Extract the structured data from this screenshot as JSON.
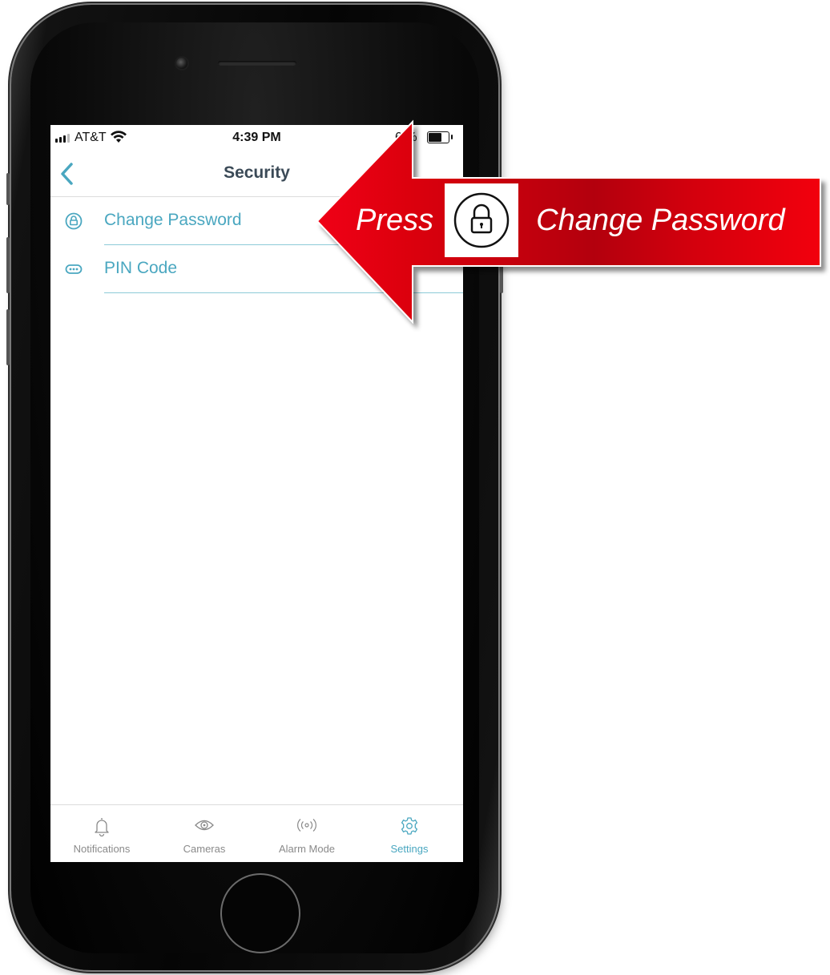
{
  "status_bar": {
    "carrier": "AT&T",
    "time": "4:39 PM",
    "battery_text": "6 %"
  },
  "nav": {
    "title": "Security"
  },
  "menu": [
    {
      "label": "Change Password",
      "icon": "lock-circle-icon"
    },
    {
      "label": "PIN Code",
      "icon": "dots-pill-icon"
    }
  ],
  "tabs": [
    {
      "label": "Notifications",
      "icon": "bell-icon",
      "active": false
    },
    {
      "label": "Cameras",
      "icon": "eye-icon",
      "active": false
    },
    {
      "label": "Alarm Mode",
      "icon": "broadcast-icon",
      "active": false
    },
    {
      "label": "Settings",
      "icon": "gear-icon",
      "active": true
    }
  ],
  "callout": {
    "prefix": "Press",
    "icon": "lock-circle-icon",
    "label": "Change Password"
  },
  "colors": {
    "accent": "#4aa7c0",
    "title": "#3b4a57",
    "callout_red": "#e2001a",
    "tab_inactive": "#8a8a8a"
  }
}
